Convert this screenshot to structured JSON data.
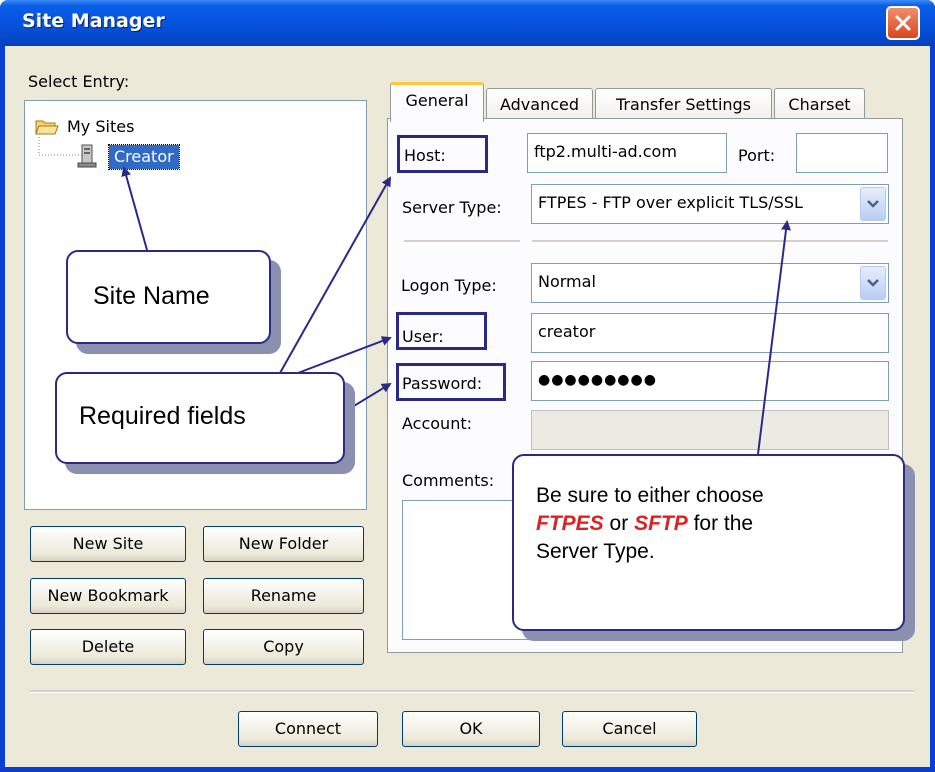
{
  "window": {
    "title": "Site Manager"
  },
  "left": {
    "select_entry_label": "Select Entry:",
    "tree": {
      "root_label": "My Sites",
      "child_label": "Creator"
    },
    "buttons": {
      "new_site": "New Site",
      "new_folder": "New Folder",
      "new_bookmark": "New Bookmark",
      "rename": "Rename",
      "delete": "Delete",
      "copy": "Copy"
    }
  },
  "tabs": [
    {
      "label": "General",
      "active": true
    },
    {
      "label": "Advanced"
    },
    {
      "label": "Transfer Settings"
    },
    {
      "label": "Charset"
    }
  ],
  "general": {
    "host_label": "Host:",
    "host_value": "ftp2.multi-ad.com",
    "port_label": "Port:",
    "port_value": "",
    "server_type_label": "Server Type:",
    "server_type_value": "FTPES - FTP over explicit TLS/SSL",
    "logon_type_label": "Logon Type:",
    "logon_type_value": "Normal",
    "user_label": "User:",
    "user_value": "creator",
    "password_label": "Password:",
    "password_value": "●●●●●●●●●",
    "account_label": "Account:",
    "account_value": "",
    "comments_label": "Comments:"
  },
  "footer": {
    "connect": "Connect",
    "ok": "OK",
    "cancel": "Cancel"
  },
  "annotations": {
    "site_name": "Site Name",
    "required_fields": "Required fields",
    "server_note": {
      "line1": "Be sure to either choose",
      "ftpes": "FTPES",
      "or": "or",
      "sftp": "SFTP",
      "for_the": "for the",
      "line3": "Server Type."
    }
  },
  "colors": {
    "title_blue": "#0653df",
    "callout_border": "#2a2a86",
    "emphasis_red": "#e02020",
    "tree_selection": "#316ac5"
  }
}
